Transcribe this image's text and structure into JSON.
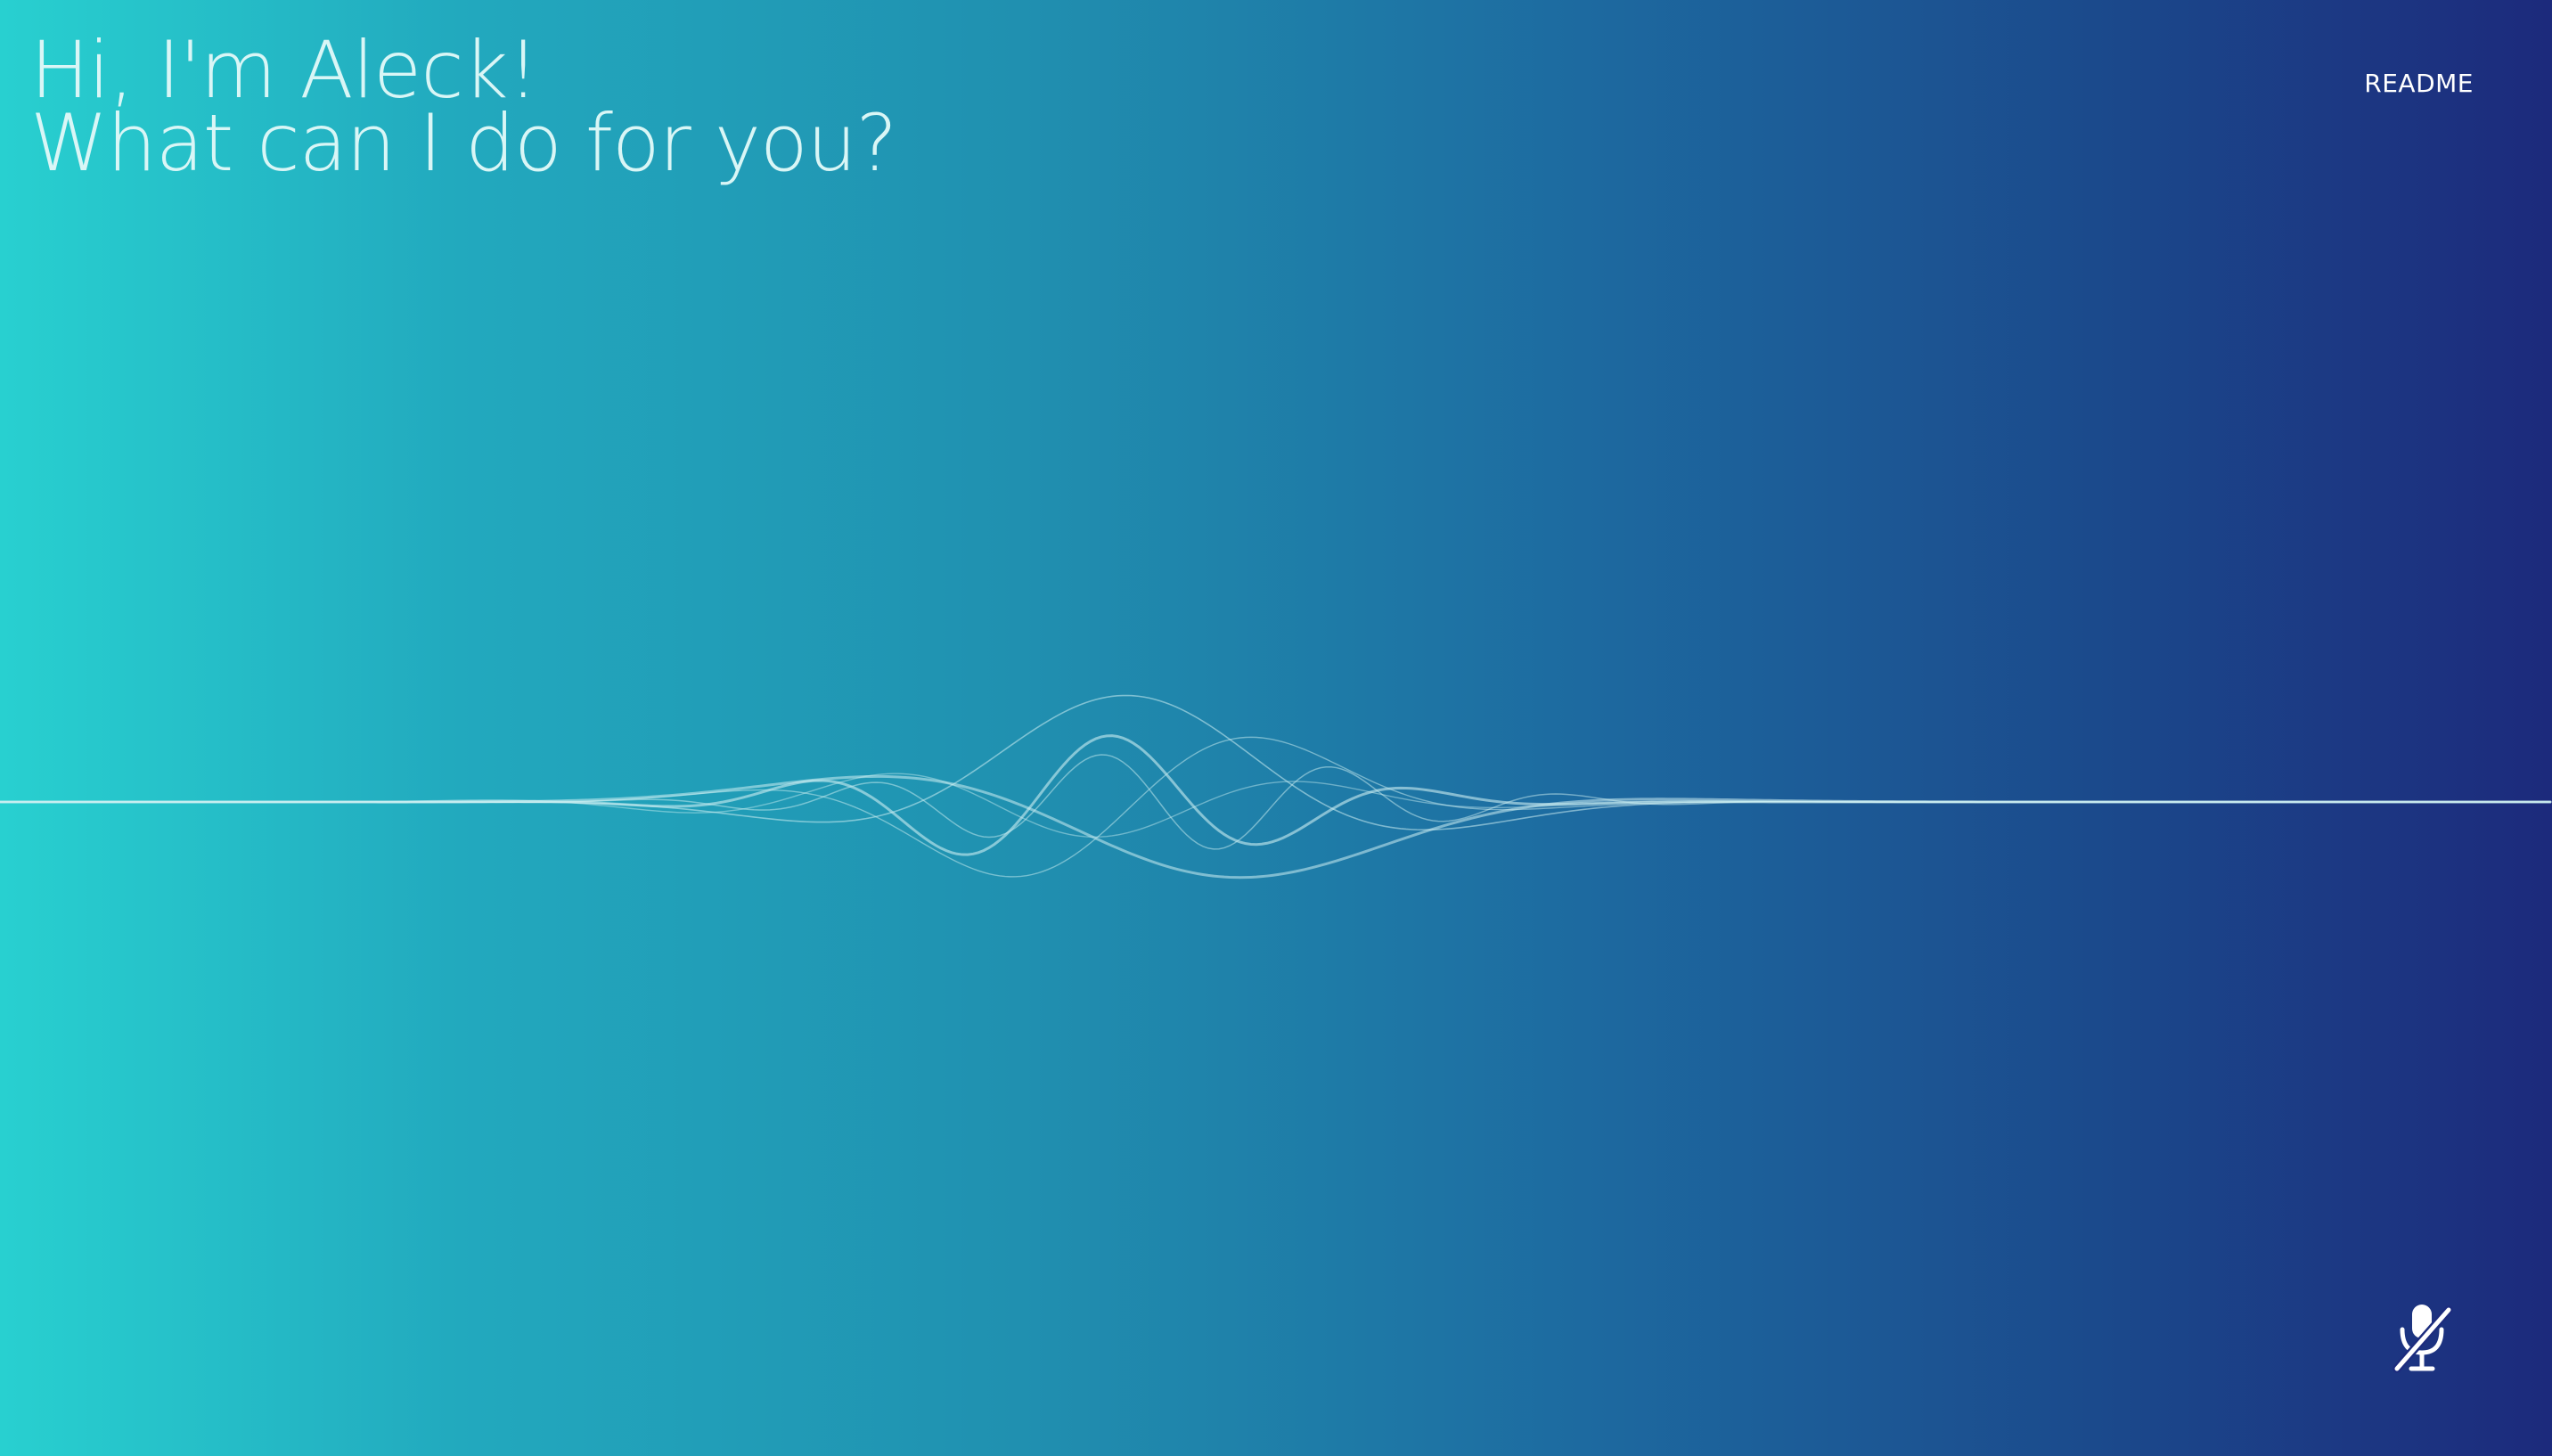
{
  "greeting": {
    "line1": "Hi, I'm Aleck!",
    "line2": "What can I do for you?"
  },
  "nav": {
    "readme_label": "README"
  },
  "mic": {
    "icon": "microphone-muted-icon",
    "state": "muted"
  },
  "colors": {
    "gradient_start": "#28d0d0",
    "gradient_end": "#1c2a7c",
    "text": "#d9f6f6",
    "wave_line": "#bfeaf0"
  }
}
